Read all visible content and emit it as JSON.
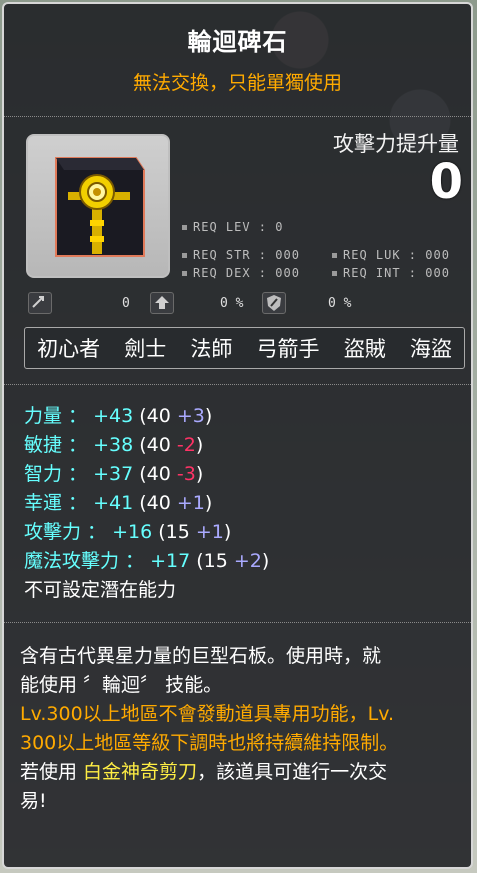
{
  "item": {
    "name": "輪迴碑石",
    "trade_note": "無法交換，只能單獨使用",
    "attack_increase_label": "攻擊力提升量",
    "attack_increase_value": "0",
    "icon_name": "samsara-stone-icon"
  },
  "requirements": {
    "lev": "REQ LEV :   0",
    "str": "REQ STR : 000",
    "luk": "REQ LUK : 000",
    "dex": "REQ DEX : 000",
    "int": "REQ INT : 000"
  },
  "small_stats": [
    {
      "icon": "transfer-icon",
      "value": "0"
    },
    {
      "icon": "upgrade-icon",
      "value": "0 %"
    },
    {
      "icon": "shield-icon",
      "value": "0 %"
    }
  ],
  "jobs": [
    "初心者",
    "劍士",
    "法師",
    "弓箭手",
    "盜賊",
    "海盜"
  ],
  "stats": [
    {
      "name": "力量 ：",
      "total": "+43",
      "base": "(40",
      "bonus": "+3",
      "bonus_sign": "pos"
    },
    {
      "name": "敏捷 ：",
      "total": "+38",
      "base": "(40",
      "bonus": "-2",
      "bonus_sign": "neg"
    },
    {
      "name": "智力 ：",
      "total": "+37",
      "base": "(40",
      "bonus": "-3",
      "bonus_sign": "neg"
    },
    {
      "name": "幸運 ：",
      "total": "+41",
      "base": "(40",
      "bonus": "+1",
      "bonus_sign": "pos"
    },
    {
      "name": "攻擊力 ：",
      "total": "+16",
      "base": "(15",
      "bonus": "+1",
      "bonus_sign": "pos"
    },
    {
      "name": "魔法攻擊力 ：",
      "total": "+17",
      "base": "(15",
      "bonus": "+2",
      "bonus_sign": "pos"
    }
  ],
  "potential_text": "不可設定潛在能力",
  "description": {
    "line1": "含有古代異星力量的巨型石板。使用時，就",
    "line2": "能使用 〞輪迴〞 技能。",
    "orange1": "Lv.300以上地區不會發動道具專用功能，Lv.",
    "orange2": "300以上地區等級下調時也將持續維持限制。",
    "line5_prefix": "若使用 ",
    "highlight": "白金神奇剪刀",
    "line5_suffix": "，該道具可進行一次交",
    "line6": "易!"
  },
  "colors": {
    "stat_name": "#66ffff",
    "bonus_positive": "#aaaaff",
    "bonus_negative": "#ff3366",
    "trade_note": "#ffaa00",
    "highlight": "#ffee44"
  }
}
